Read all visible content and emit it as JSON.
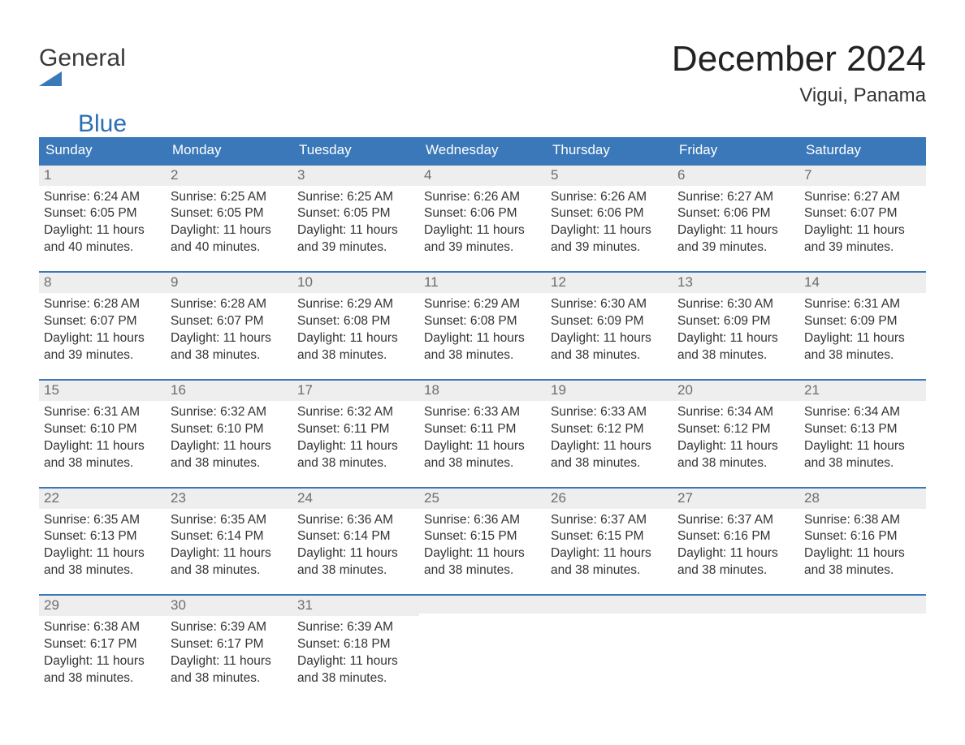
{
  "logo": {
    "line1": "General",
    "line2": "Blue"
  },
  "title": "December 2024",
  "location": "Vigui, Panama",
  "day_headers": [
    "Sunday",
    "Monday",
    "Tuesday",
    "Wednesday",
    "Thursday",
    "Friday",
    "Saturday"
  ],
  "start_offset": 0,
  "days": [
    {
      "n": "1",
      "sunrise": "Sunrise: 6:24 AM",
      "sunset": "Sunset: 6:05 PM",
      "daylight": "Daylight: 11 hours and 40 minutes."
    },
    {
      "n": "2",
      "sunrise": "Sunrise: 6:25 AM",
      "sunset": "Sunset: 6:05 PM",
      "daylight": "Daylight: 11 hours and 40 minutes."
    },
    {
      "n": "3",
      "sunrise": "Sunrise: 6:25 AM",
      "sunset": "Sunset: 6:05 PM",
      "daylight": "Daylight: 11 hours and 39 minutes."
    },
    {
      "n": "4",
      "sunrise": "Sunrise: 6:26 AM",
      "sunset": "Sunset: 6:06 PM",
      "daylight": "Daylight: 11 hours and 39 minutes."
    },
    {
      "n": "5",
      "sunrise": "Sunrise: 6:26 AM",
      "sunset": "Sunset: 6:06 PM",
      "daylight": "Daylight: 11 hours and 39 minutes."
    },
    {
      "n": "6",
      "sunrise": "Sunrise: 6:27 AM",
      "sunset": "Sunset: 6:06 PM",
      "daylight": "Daylight: 11 hours and 39 minutes."
    },
    {
      "n": "7",
      "sunrise": "Sunrise: 6:27 AM",
      "sunset": "Sunset: 6:07 PM",
      "daylight": "Daylight: 11 hours and 39 minutes."
    },
    {
      "n": "8",
      "sunrise": "Sunrise: 6:28 AM",
      "sunset": "Sunset: 6:07 PM",
      "daylight": "Daylight: 11 hours and 39 minutes."
    },
    {
      "n": "9",
      "sunrise": "Sunrise: 6:28 AM",
      "sunset": "Sunset: 6:07 PM",
      "daylight": "Daylight: 11 hours and 38 minutes."
    },
    {
      "n": "10",
      "sunrise": "Sunrise: 6:29 AM",
      "sunset": "Sunset: 6:08 PM",
      "daylight": "Daylight: 11 hours and 38 minutes."
    },
    {
      "n": "11",
      "sunrise": "Sunrise: 6:29 AM",
      "sunset": "Sunset: 6:08 PM",
      "daylight": "Daylight: 11 hours and 38 minutes."
    },
    {
      "n": "12",
      "sunrise": "Sunrise: 6:30 AM",
      "sunset": "Sunset: 6:09 PM",
      "daylight": "Daylight: 11 hours and 38 minutes."
    },
    {
      "n": "13",
      "sunrise": "Sunrise: 6:30 AM",
      "sunset": "Sunset: 6:09 PM",
      "daylight": "Daylight: 11 hours and 38 minutes."
    },
    {
      "n": "14",
      "sunrise": "Sunrise: 6:31 AM",
      "sunset": "Sunset: 6:09 PM",
      "daylight": "Daylight: 11 hours and 38 minutes."
    },
    {
      "n": "15",
      "sunrise": "Sunrise: 6:31 AM",
      "sunset": "Sunset: 6:10 PM",
      "daylight": "Daylight: 11 hours and 38 minutes."
    },
    {
      "n": "16",
      "sunrise": "Sunrise: 6:32 AM",
      "sunset": "Sunset: 6:10 PM",
      "daylight": "Daylight: 11 hours and 38 minutes."
    },
    {
      "n": "17",
      "sunrise": "Sunrise: 6:32 AM",
      "sunset": "Sunset: 6:11 PM",
      "daylight": "Daylight: 11 hours and 38 minutes."
    },
    {
      "n": "18",
      "sunrise": "Sunrise: 6:33 AM",
      "sunset": "Sunset: 6:11 PM",
      "daylight": "Daylight: 11 hours and 38 minutes."
    },
    {
      "n": "19",
      "sunrise": "Sunrise: 6:33 AM",
      "sunset": "Sunset: 6:12 PM",
      "daylight": "Daylight: 11 hours and 38 minutes."
    },
    {
      "n": "20",
      "sunrise": "Sunrise: 6:34 AM",
      "sunset": "Sunset: 6:12 PM",
      "daylight": "Daylight: 11 hours and 38 minutes."
    },
    {
      "n": "21",
      "sunrise": "Sunrise: 6:34 AM",
      "sunset": "Sunset: 6:13 PM",
      "daylight": "Daylight: 11 hours and 38 minutes."
    },
    {
      "n": "22",
      "sunrise": "Sunrise: 6:35 AM",
      "sunset": "Sunset: 6:13 PM",
      "daylight": "Daylight: 11 hours and 38 minutes."
    },
    {
      "n": "23",
      "sunrise": "Sunrise: 6:35 AM",
      "sunset": "Sunset: 6:14 PM",
      "daylight": "Daylight: 11 hours and 38 minutes."
    },
    {
      "n": "24",
      "sunrise": "Sunrise: 6:36 AM",
      "sunset": "Sunset: 6:14 PM",
      "daylight": "Daylight: 11 hours and 38 minutes."
    },
    {
      "n": "25",
      "sunrise": "Sunrise: 6:36 AM",
      "sunset": "Sunset: 6:15 PM",
      "daylight": "Daylight: 11 hours and 38 minutes."
    },
    {
      "n": "26",
      "sunrise": "Sunrise: 6:37 AM",
      "sunset": "Sunset: 6:15 PM",
      "daylight": "Daylight: 11 hours and 38 minutes."
    },
    {
      "n": "27",
      "sunrise": "Sunrise: 6:37 AM",
      "sunset": "Sunset: 6:16 PM",
      "daylight": "Daylight: 11 hours and 38 minutes."
    },
    {
      "n": "28",
      "sunrise": "Sunrise: 6:38 AM",
      "sunset": "Sunset: 6:16 PM",
      "daylight": "Daylight: 11 hours and 38 minutes."
    },
    {
      "n": "29",
      "sunrise": "Sunrise: 6:38 AM",
      "sunset": "Sunset: 6:17 PM",
      "daylight": "Daylight: 11 hours and 38 minutes."
    },
    {
      "n": "30",
      "sunrise": "Sunrise: 6:39 AM",
      "sunset": "Sunset: 6:17 PM",
      "daylight": "Daylight: 11 hours and 38 minutes."
    },
    {
      "n": "31",
      "sunrise": "Sunrise: 6:39 AM",
      "sunset": "Sunset: 6:18 PM",
      "daylight": "Daylight: 11 hours and 38 minutes."
    }
  ]
}
